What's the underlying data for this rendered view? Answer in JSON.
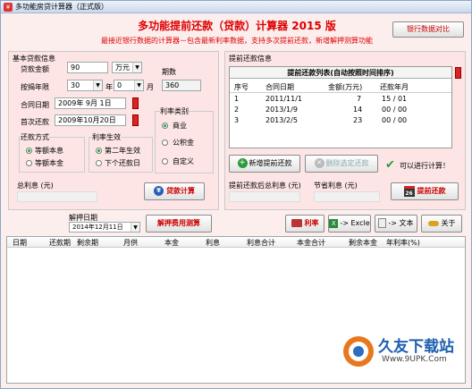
{
  "window": {
    "title": "多功能房贷计算器（正式版）"
  },
  "header": {
    "title": "多功能提前还款（贷款）计算器 2015 版",
    "subtitle": "最接近银行数据的计算器－包含最新利率数据，支持多次提前还款，新增解押测算功能",
    "bank_compare_button": "银行数据对比"
  },
  "basic": {
    "section_title": "基本贷款信息",
    "amount_label": "贷款金额",
    "amount_value": "90",
    "amount_unit": "万元",
    "term_label": "按揭年限",
    "years_value": "30",
    "years_unit": "年",
    "months_value": "0",
    "months_unit": "月",
    "period_label": "期数",
    "period_value": "360",
    "contract_date_label": "合同日期",
    "contract_date": "2009年 9月 1日",
    "first_pay_label": "首次还款",
    "first_pay_date": "2009年10月20日",
    "rate_type_title": "利率类别",
    "rate_types": [
      "商业",
      "公积金",
      "自定义"
    ],
    "repay_method_title": "还款方式",
    "repay_methods": [
      "等额本息",
      "等额本金"
    ],
    "rate_effect_title": "利率生效",
    "rate_effects": [
      "第二年生效",
      "下个还款日"
    ],
    "total_interest_label": "总利息 (元)",
    "calc_button": "贷款计算"
  },
  "prepay": {
    "section_title": "提前还款信息",
    "list_title": "提前还款列表(自动按照时间排序)",
    "columns": [
      "序号",
      "合同日期",
      "金额(万元)",
      "还款年月"
    ],
    "rows": [
      {
        "no": "1",
        "date": "2011/11/1",
        "amount": "7",
        "ym": "15 / 01"
      },
      {
        "no": "2",
        "date": "2013/1/9",
        "amount": "14",
        "ym": "00 / 00"
      },
      {
        "no": "3",
        "date": "2013/2/5",
        "amount": "23",
        "ym": "00 / 00"
      }
    ],
    "add_button": "新增提前还款",
    "delete_button": "删除选定还款",
    "status_text": "可以进行计算！",
    "total_after_label": "提前还款后总利息 (元)",
    "saved_label": "节省利息 (元)",
    "prepay_button": "提前还款"
  },
  "toolbar": {
    "release_date_label": "解押日期",
    "release_date": "2014年12月11日",
    "release_calc_button": "解押费用测算",
    "rate_button": "利率",
    "excel_button": "-> Excle",
    "text_button": "-> 文本",
    "about_button": "关于"
  },
  "table": {
    "columns": [
      "日期",
      "还款期",
      "剩余期",
      "月供",
      "本金",
      "利息",
      "利息合计",
      "本金合计",
      "剩余本金",
      "年利率(%)"
    ]
  },
  "watermark": {
    "text": "久友下载站",
    "url_text": "Www.9UPK.Com"
  },
  "colors": {
    "accent_red": "#dd0000",
    "panel_bg": "#fdeeee",
    "title_gradient_top": "#eef3fa"
  }
}
